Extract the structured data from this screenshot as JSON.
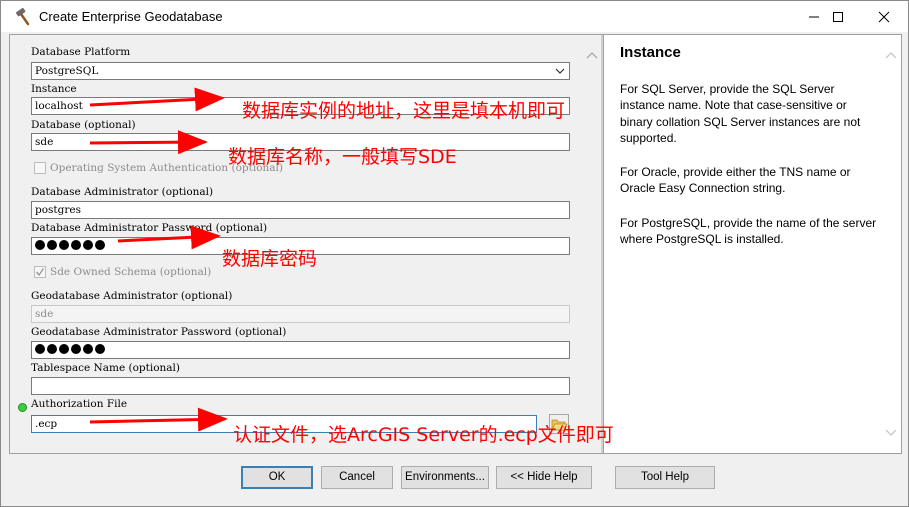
{
  "window": {
    "title": "Create Enterprise Geodatabase"
  },
  "form": {
    "platform_label": "Database Platform",
    "platform_value": "PostgreSQL",
    "instance_label": "Instance",
    "instance_value": "localhost",
    "database_label": "Database (optional)",
    "database_value": "sde",
    "os_auth_label": "Operating System Authentication (optional)",
    "db_admin_label": "Database Administrator (optional)",
    "db_admin_value": "postgres",
    "db_admin_pwd_label": "Database Administrator Password (optional)",
    "sde_owned_label": "Sde Owned Schema (optional)",
    "gdb_admin_label": "Geodatabase Administrator (optional)",
    "gdb_admin_value": "sde",
    "gdb_admin_pwd_label": "Geodatabase Administrator Password (optional)",
    "tablespace_label": "Tablespace Name (optional)",
    "tablespace_value": "",
    "auth_file_label": "Authorization File",
    "auth_file_value": ".ecp"
  },
  "help": {
    "title": "Instance",
    "p1": "For SQL Server, provide the SQL Server instance name. Note that case-sensitive or binary collation SQL Server instances are not supported.",
    "p2": "For Oracle, provide either the TNS name or Oracle Easy Connection string.",
    "p3": "For PostgreSQL, provide the name of the server where PostgreSQL is installed."
  },
  "annotations": {
    "instance": "数据库实例的地址，这里是填本机即可",
    "database": "数据库名称，一般填写SDE",
    "password": "数据库密码",
    "auth": "认证文件，选ArcGIS Server的.ecp文件即可"
  },
  "buttons": {
    "ok": "OK",
    "cancel": "Cancel",
    "environments": "Environments...",
    "hide_help": "<< Hide Help",
    "tool_help": "Tool Help"
  },
  "colors": {
    "annotation": "#ff0000",
    "required_dot": "#3dcc3d",
    "default_button_border": "#3c7fb1"
  },
  "icons": [
    "hammer-icon",
    "minimize-icon",
    "maximize-icon",
    "close-icon",
    "chevron-down-icon",
    "checkmark-icon",
    "folder-open-icon",
    "scroll-up-icon",
    "scroll-down-icon"
  ]
}
